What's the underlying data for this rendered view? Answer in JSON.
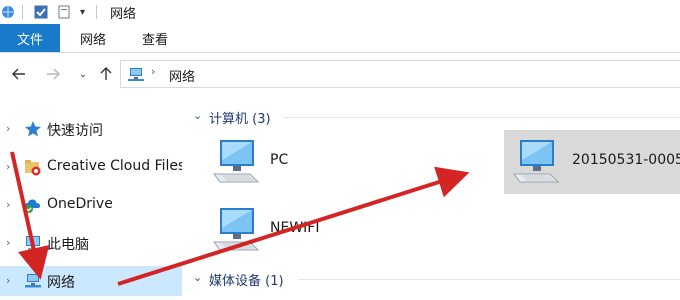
{
  "window": {
    "title": "网络"
  },
  "ribbon": {
    "tabs": [
      "文件",
      "网络",
      "查看"
    ]
  },
  "address": {
    "crumb": "网络"
  },
  "nav": {
    "items": [
      {
        "label": "快速访问"
      },
      {
        "label": "Creative Cloud Files"
      },
      {
        "label": "OneDrive"
      },
      {
        "label": "此电脑"
      },
      {
        "label": "网络"
      }
    ]
  },
  "groups": {
    "computers": {
      "title": "计算机 (3)",
      "items": [
        "PC",
        "NEWIFI",
        "20150531-0005"
      ]
    },
    "media": {
      "title": "媒体设备 (1)"
    }
  },
  "colors": {
    "accent": "#1979ca",
    "selected_nav": "#cce8ff",
    "selected_tile": "#d9d9d9",
    "annotation_arrow": "#d42525"
  }
}
